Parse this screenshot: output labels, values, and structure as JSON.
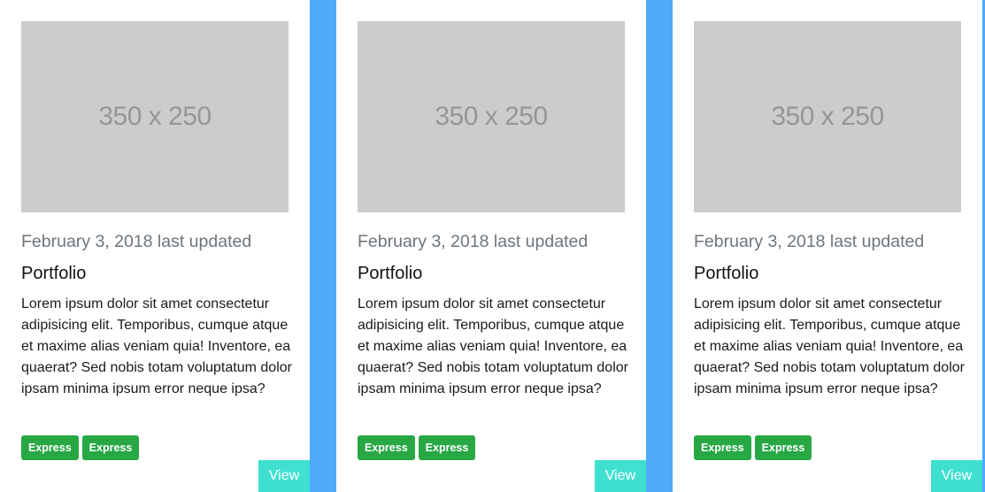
{
  "colors": {
    "background_accent": "#4dabf7",
    "card_background": "#ffffff",
    "placeholder": "#cccccc",
    "tag_background": "#28a745",
    "view_button": "#40e0d0"
  },
  "cards": [
    {
      "image_text": "350 x 250",
      "date": "February 3, 2018 last updated",
      "title": "Portfolio",
      "description": "Lorem ipsum dolor sit amet consectetur adipisicing elit. Temporibus, cumque atque et maxime alias veniam quia! Inventore, ea quaerat? Sed nobis totam voluptatum dolor ipsam minima ipsum error neque ipsa?",
      "tags": [
        "Express",
        "Express"
      ],
      "view_label": "View"
    },
    {
      "image_text": "350 x 250",
      "date": "February 3, 2018 last updated",
      "title": "Portfolio",
      "description": "Lorem ipsum dolor sit amet consectetur adipisicing elit. Temporibus, cumque atque et maxime alias veniam quia! Inventore, ea quaerat? Sed nobis totam voluptatum dolor ipsam minima ipsum error neque ipsa?",
      "tags": [
        "Express",
        "Express"
      ],
      "view_label": "View"
    },
    {
      "image_text": "350 x 250",
      "date": "February 3, 2018 last updated",
      "title": "Portfolio",
      "description": "Lorem ipsum dolor sit amet consectetur adipisicing elit. Temporibus, cumque atque et maxime alias veniam quia! Inventore, ea quaerat? Sed nobis totam voluptatum dolor ipsam minima ipsum error neque ipsa?",
      "tags": [
        "Express",
        "Express"
      ],
      "view_label": "View"
    }
  ]
}
